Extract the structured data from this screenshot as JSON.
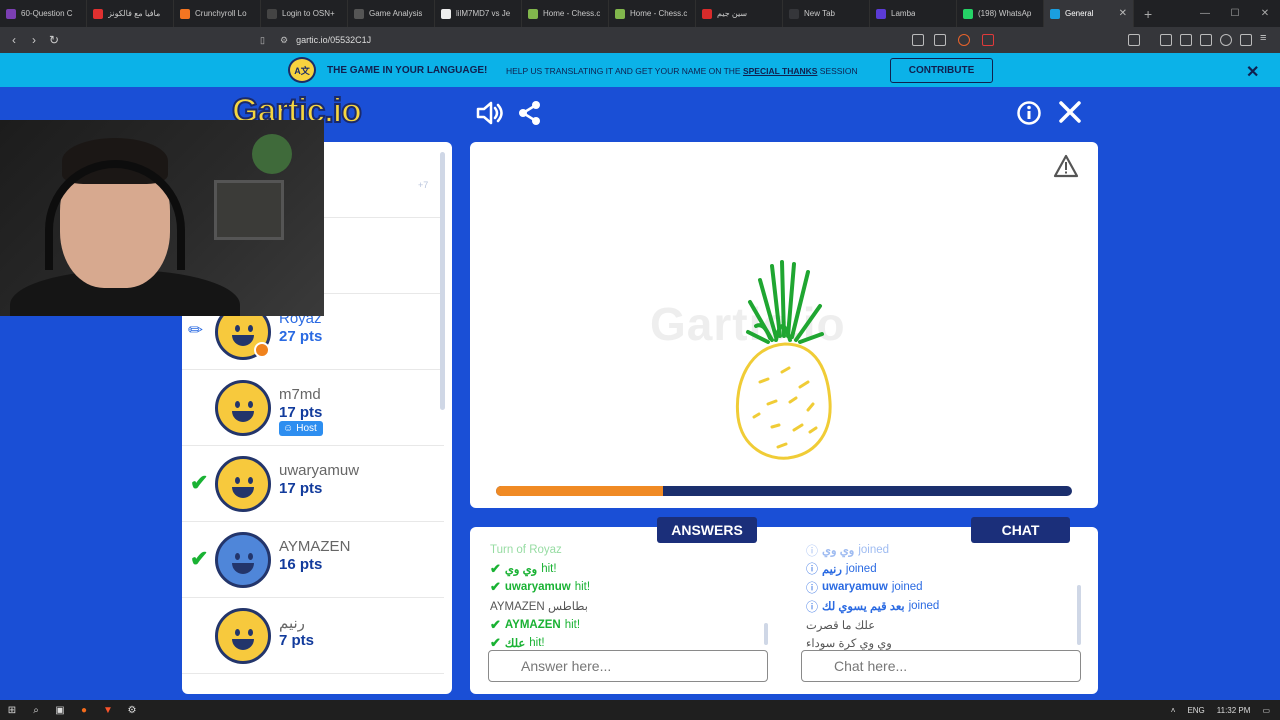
{
  "browser": {
    "tabs": [
      {
        "label": "60-Question C",
        "color": "#7b3fb3"
      },
      {
        "label": "مافيا مع فالكونز",
        "color": "#e03030"
      },
      {
        "label": "Crunchyroll Lo",
        "color": "#f47521"
      },
      {
        "label": "Login to OSN+",
        "color": "#444444"
      },
      {
        "label": "Game Analysis",
        "color": "#555555"
      },
      {
        "label": "lilM7MD7 vs Je",
        "color": "#eeeeee"
      },
      {
        "label": "Home - Chess.c",
        "color": "#81b64c"
      },
      {
        "label": "Home - Chess.c",
        "color": "#81b64c"
      },
      {
        "label": "سين جيم",
        "color": "#d92b2b"
      },
      {
        "label": "New Tab",
        "color": "#35363a"
      },
      {
        "label": "Lamba",
        "color": "#5b3bd6"
      },
      {
        "label": "(198) WhatsAp",
        "color": "#25d366"
      },
      {
        "label": "General",
        "color": "#1a9fe0"
      }
    ],
    "url": "gartic.io/05532C1J"
  },
  "banner": {
    "icon_text": "A文",
    "strong": "THE GAME IN YOUR LANGUAGE!",
    "text_before": "HELP US TRANSLATING IT AND GET YOUR NAME ON THE ",
    "text_link": "SPECIAL THANKS",
    "text_after": " SESSION",
    "button": "CONTRIBUTE"
  },
  "game": {
    "logo": "Gartic.io",
    "watermark": "Gartic.io",
    "timer_fraction": 0.29,
    "players": [
      {
        "name": "",
        "pts": "",
        "hidden": true,
        "extra": "+7"
      },
      {
        "name": "",
        "pts": "",
        "hidden": true
      },
      {
        "name": "Royaz",
        "pts": "27 pts",
        "drawer": true
      },
      {
        "name": "m7md",
        "pts": "17 pts",
        "host": "Host"
      },
      {
        "name": "uwaryamuw",
        "pts": "17 pts",
        "guessed": true
      },
      {
        "name": "AYMAZEN",
        "pts": "16 pts",
        "guessed": true
      },
      {
        "name": "رنيم",
        "pts": "7 pts"
      }
    ],
    "answers_tab": "ANSWERS",
    "chat_tab": "CHAT",
    "answers": [
      {
        "type": "faded",
        "text": "Turn of Royaz"
      },
      {
        "type": "hit",
        "name": "وي وي",
        "hit": "hit!"
      },
      {
        "type": "hit",
        "name": "uwaryamuw",
        "hit": "hit!"
      },
      {
        "type": "plain",
        "text": "AYMAZEN بطاطس"
      },
      {
        "type": "hit",
        "name": "AYMAZEN",
        "hit": "hit!"
      },
      {
        "type": "hit",
        "name": "علك",
        "hit": "hit!"
      }
    ],
    "chat": [
      {
        "type": "join",
        "name": "وي وي",
        "joined": "joined",
        "faded": true
      },
      {
        "type": "join",
        "name": "رنيم",
        "joined": "joined"
      },
      {
        "type": "join",
        "name": "uwaryamuw",
        "joined": "joined"
      },
      {
        "type": "join",
        "name": "بعد قيم يسوي لك",
        "joined": "joined"
      },
      {
        "type": "plain",
        "text": "علك ما قصرت"
      },
      {
        "type": "plain",
        "text": "وي وي كرة سوداء"
      }
    ],
    "answer_placeholder": "Answer here...",
    "chat_placeholder": "Chat here..."
  },
  "taskbar": {
    "lang": "ENG",
    "time": "11:32 PM"
  }
}
